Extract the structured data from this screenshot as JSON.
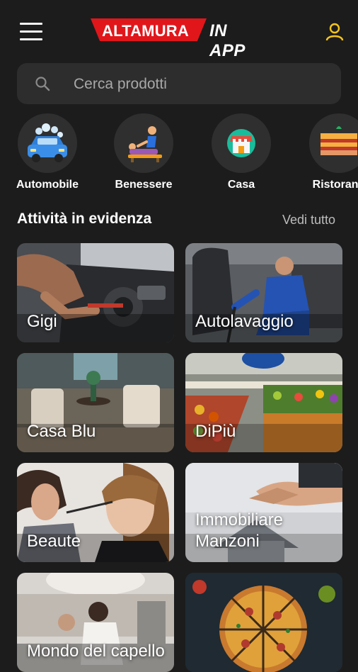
{
  "header": {
    "logo_main": "ALTAMURA",
    "logo_suffix": "IN APP",
    "menu_icon": "hamburger-menu-icon",
    "user_icon": "user-profile-icon",
    "accent_red": "#e1161b",
    "user_icon_color": "#f5c518"
  },
  "search": {
    "placeholder": "Cerca prodotti",
    "icon": "search-icon"
  },
  "categories": [
    {
      "label": "Automobile",
      "icon": "car-wash-icon"
    },
    {
      "label": "Benessere",
      "icon": "massage-icon"
    },
    {
      "label": "Casa",
      "icon": "shop-store-icon"
    },
    {
      "label": "Ristoranti",
      "icon": "lasagna-food-icon"
    }
  ],
  "featured": {
    "title": "Attività in evidenza",
    "see_all": "Vedi tutto",
    "items": [
      {
        "name": "Gigi"
      },
      {
        "name": "Autolavaggio"
      },
      {
        "name": "Casa Blu"
      },
      {
        "name": "DiPiù"
      },
      {
        "name": "Beaute"
      },
      {
        "name": "Immobiliare Manzoni"
      },
      {
        "name": "Mondo del capello"
      },
      {
        "name": ""
      }
    ]
  }
}
